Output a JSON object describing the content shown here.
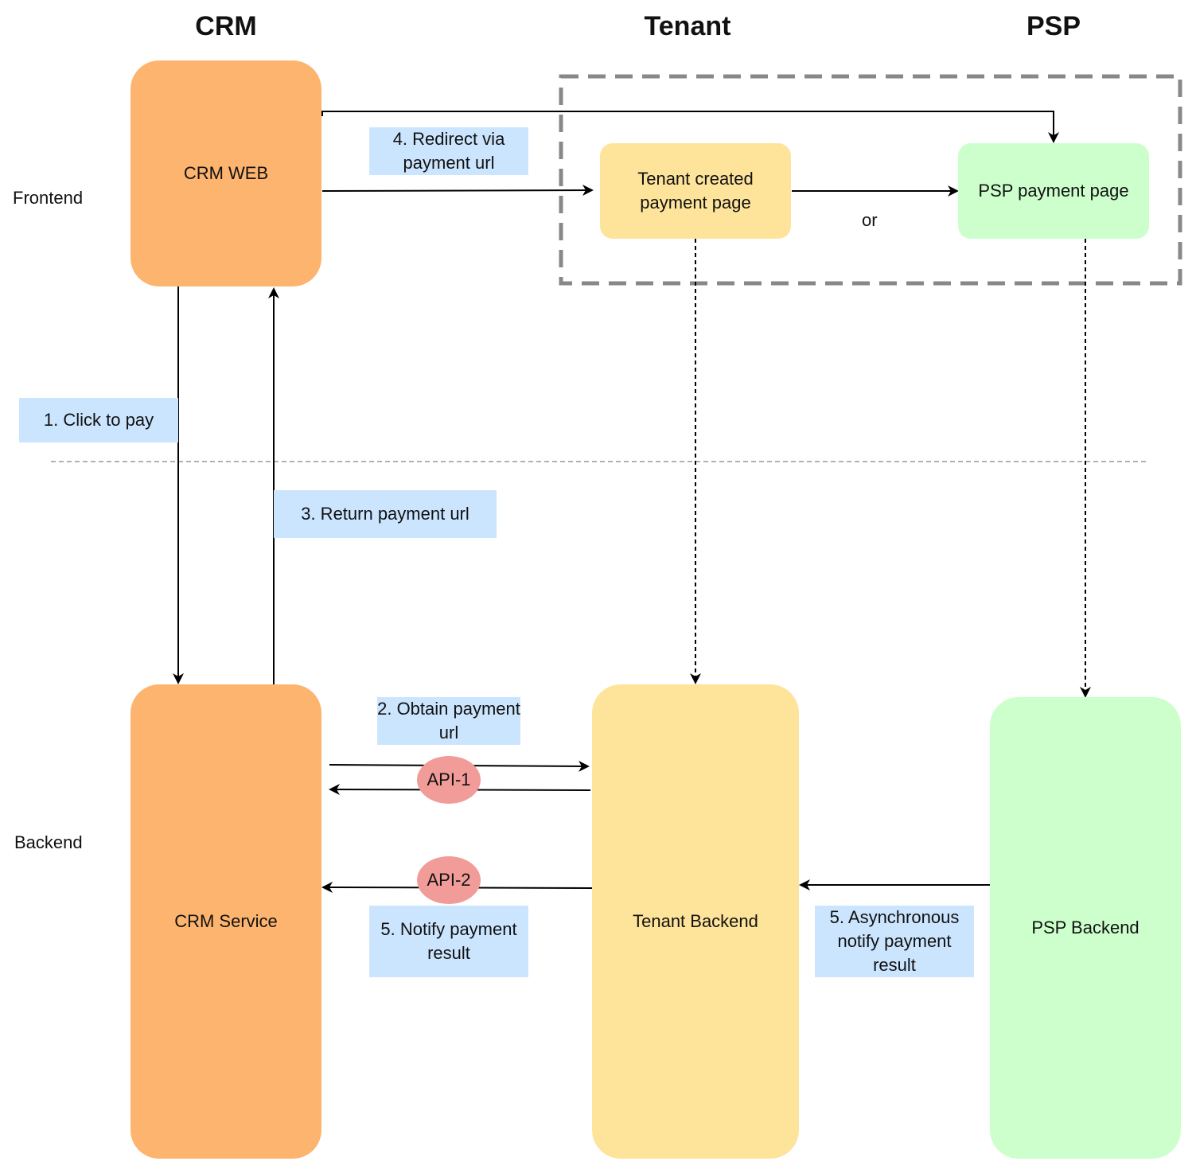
{
  "columns": {
    "crm": "CRM",
    "tenant": "Tenant",
    "psp": "PSP"
  },
  "layers": {
    "frontend": "Frontend",
    "backend": "Backend"
  },
  "nodes": {
    "crm_web": "CRM WEB",
    "tenant_page": "Tenant created payment page",
    "psp_page": "PSP payment page",
    "crm_service": "CRM Service",
    "tenant_backend": "Tenant Backend",
    "psp_backend": "PSP Backend"
  },
  "notes": {
    "step1": "1. Click to pay",
    "step2": "2. Obtain payment url",
    "step3": "3. Return payment url",
    "step4": "4. Redirect via payment url",
    "step5_notify": "5. Notify payment result",
    "step5_async": "5. Asynchronous notify payment result"
  },
  "apis": {
    "api1": "API-1",
    "api2": "API-2"
  },
  "connector_labels": {
    "or": "or"
  },
  "colors": {
    "crm": "#fdb46e",
    "tenant": "#fee49a",
    "psp": "#ccffcc",
    "note": "#cce5ff",
    "api": "#f19c99",
    "group_border": "#888888",
    "divider": "#999999"
  }
}
